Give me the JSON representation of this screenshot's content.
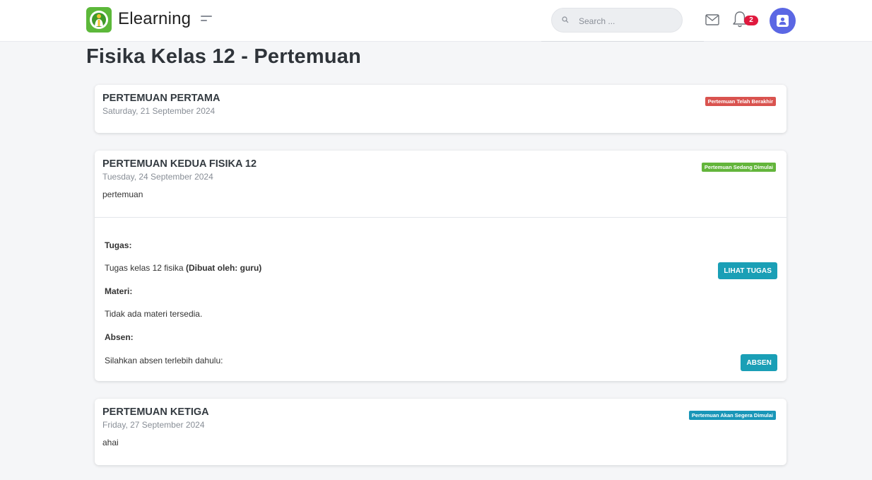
{
  "header": {
    "brand": "Elearning",
    "search_placeholder": "Search ...",
    "notification_count": "2"
  },
  "page_title": "Fisika Kelas 12 - Pertemuan",
  "meetings": [
    {
      "title": "PERTEMUAN PERTAMA",
      "date": "Saturday, 21 September 2024",
      "status": "Pertemuan Telah Berakhir",
      "status_color": "#d9534f"
    },
    {
      "title": "PERTEMUAN KEDUA FISIKA 12",
      "date": "Tuesday, 24 September 2024",
      "description": "pertemuan",
      "status": "Pertemuan Sedang Dimulai",
      "status_color": "#63b53b",
      "tugas_label": "Tugas:",
      "tugas_name": "Tugas kelas 12 fisika",
      "tugas_author": "(Dibuat oleh: guru)",
      "lihat_tugas_button": "LIHAT TUGAS",
      "materi_label": "Materi:",
      "materi_text": "Tidak ada materi tersedia.",
      "absen_label": "Absen:",
      "absen_text": "Silahkan absen terlebih dahulu:",
      "absen_button": "ABSEN"
    },
    {
      "title": "PERTEMUAN KETIGA",
      "date": "Friday, 27 September 2024",
      "description": "ahai",
      "status": "Pertemuan Akan Segera Dimulai",
      "status_color": "#1996b8"
    }
  ],
  "icons": {
    "logo": "elearning-logo",
    "menu": "menu-toggle-icon",
    "search": "search-icon",
    "mail": "mail-icon",
    "notification": "bell-icon",
    "profile": "user-avatar-icon"
  },
  "colors": {
    "accent": "#1a9fb6",
    "avatar": "#5b67e4",
    "logo_green": "#5cb83a",
    "badge_red": "#e0193e"
  }
}
